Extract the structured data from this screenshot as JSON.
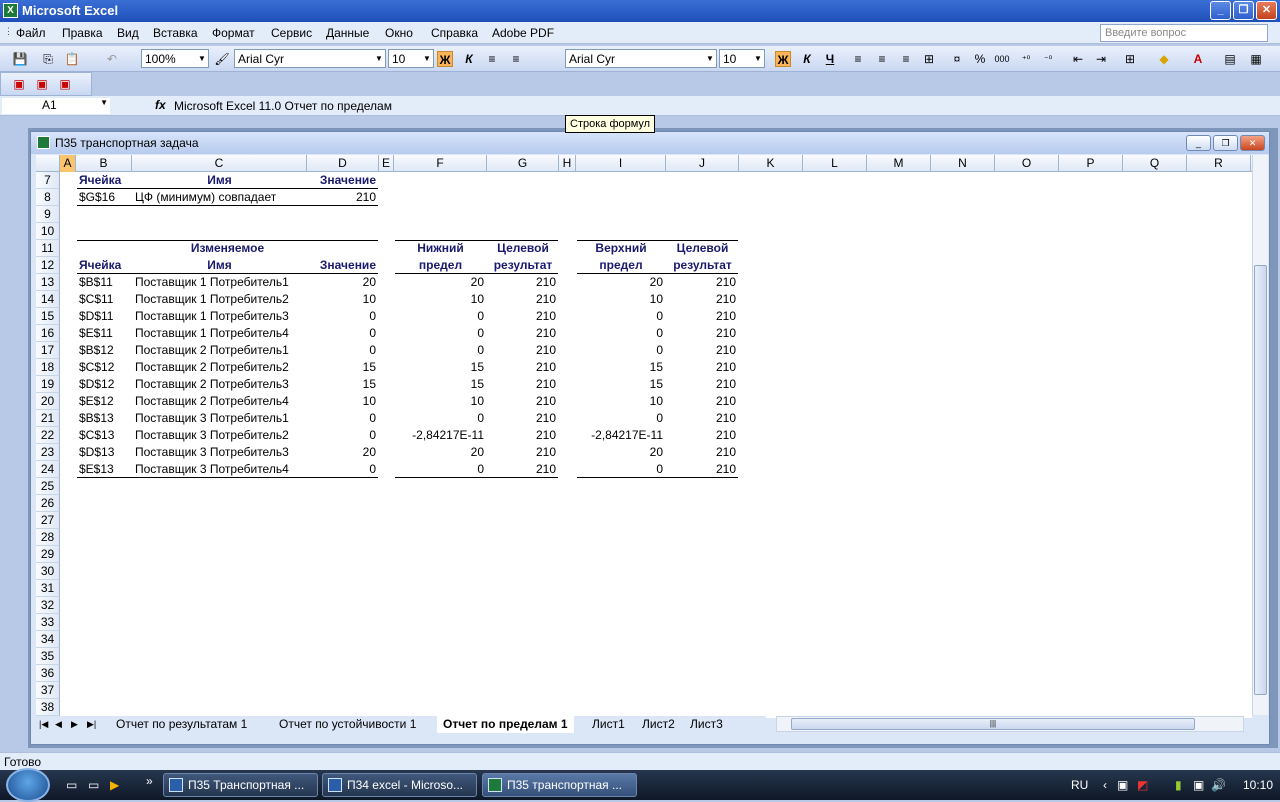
{
  "app": {
    "title": "Microsoft Excel"
  },
  "menu": [
    "Файл",
    "Правка",
    "Вид",
    "Вставка",
    "Формат",
    "Сервис",
    "Данные",
    "Окно",
    "Справка",
    "Adobe PDF"
  ],
  "ask_placeholder": "Введите вопрос",
  "toolbar": {
    "zoom": "100%",
    "font1": "Arial Cyr",
    "size1": "10",
    "font2": "Arial Cyr",
    "size2": "10",
    "bold": "Ж",
    "italic": "К",
    "underline": "Ч",
    "percent": "%",
    "thousands": "000"
  },
  "formula_bar": {
    "cell_ref": "A1",
    "fx": "fx",
    "content": "Microsoft Excel 11.0 Отчет по пределам",
    "tooltip": "Строка формул"
  },
  "workbook": {
    "title": "П35 транспортная задача"
  },
  "columns": [
    "A",
    "B",
    "C",
    "D",
    "E",
    "F",
    "G",
    "H",
    "I",
    "J",
    "K",
    "L",
    "M",
    "N",
    "O",
    "P",
    "Q",
    "R"
  ],
  "rows": [
    "7",
    "8",
    "9",
    "10",
    "11",
    "12",
    "13",
    "14",
    "15",
    "16",
    "17",
    "18",
    "19",
    "20",
    "21",
    "22",
    "23",
    "24",
    "25",
    "26",
    "27",
    "28",
    "29",
    "30",
    "31",
    "32",
    "33",
    "34",
    "35",
    "36",
    "37",
    "38"
  ],
  "target": {
    "h_cell": "Ячейка",
    "h_name": "Имя",
    "h_value": "Значение",
    "cell": "$G$16",
    "name": "ЦФ (минимум) совпадает",
    "value": "210"
  },
  "adjustable": {
    "h_top": "Изменяемое",
    "h_cell": "Ячейка",
    "h_name": "Имя",
    "h_value": "Значение",
    "h_lower1": "Нижний",
    "h_lower2": "предел",
    "h_target1": "Целевой",
    "h_target2": "результат",
    "h_upper1": "Верхний",
    "h_upper2": "предел",
    "h_target3": "Целевой",
    "h_target4": "результат",
    "rows": [
      {
        "cell": "$B$11",
        "name": "Поставщик 1 Потребитель1",
        "value": "20",
        "lower": "20",
        "lres": "210",
        "upper": "20",
        "ures": "210"
      },
      {
        "cell": "$C$11",
        "name": "Поставщик 1 Потребитель2",
        "value": "10",
        "lower": "10",
        "lres": "210",
        "upper": "10",
        "ures": "210"
      },
      {
        "cell": "$D$11",
        "name": "Поставщик 1 Потребитель3",
        "value": "0",
        "lower": "0",
        "lres": "210",
        "upper": "0",
        "ures": "210"
      },
      {
        "cell": "$E$11",
        "name": "Поставщик 1 Потребитель4",
        "value": "0",
        "lower": "0",
        "lres": "210",
        "upper": "0",
        "ures": "210"
      },
      {
        "cell": "$B$12",
        "name": "Поставщик 2 Потребитель1",
        "value": "0",
        "lower": "0",
        "lres": "210",
        "upper": "0",
        "ures": "210"
      },
      {
        "cell": "$C$12",
        "name": "Поставщик 2 Потребитель2",
        "value": "15",
        "lower": "15",
        "lres": "210",
        "upper": "15",
        "ures": "210"
      },
      {
        "cell": "$D$12",
        "name": "Поставщик 2 Потребитель3",
        "value": "15",
        "lower": "15",
        "lres": "210",
        "upper": "15",
        "ures": "210"
      },
      {
        "cell": "$E$12",
        "name": "Поставщик 2 Потребитель4",
        "value": "10",
        "lower": "10",
        "lres": "210",
        "upper": "10",
        "ures": "210"
      },
      {
        "cell": "$B$13",
        "name": "Поставщик 3 Потребитель1",
        "value": "0",
        "lower": "0",
        "lres": "210",
        "upper": "0",
        "ures": "210"
      },
      {
        "cell": "$C$13",
        "name": "Поставщик 3 Потребитель2",
        "value": "0",
        "lower": "-2,84217E-11",
        "lres": "210",
        "upper": "-2,84217E-11",
        "ures": "210"
      },
      {
        "cell": "$D$13",
        "name": "Поставщик 3 Потребитель3",
        "value": "20",
        "lower": "20",
        "lres": "210",
        "upper": "20",
        "ures": "210"
      },
      {
        "cell": "$E$13",
        "name": "Поставщик 3 Потребитель4",
        "value": "0",
        "lower": "0",
        "lres": "210",
        "upper": "0",
        "ures": "210"
      }
    ]
  },
  "sheet_tabs": [
    "Отчет по результатам 1",
    "Отчет по устойчивости 1",
    "Отчет по пределам 1",
    "Лист1",
    "Лист2",
    "Лист3"
  ],
  "active_tab": "Отчет по пределам 1",
  "status": "Готово",
  "taskbar": {
    "tasks": [
      "П35 Транспортная ...",
      "П34 excel - Microso...",
      "П35 транспортная ..."
    ],
    "lang": "RU",
    "clock": "10:10"
  }
}
